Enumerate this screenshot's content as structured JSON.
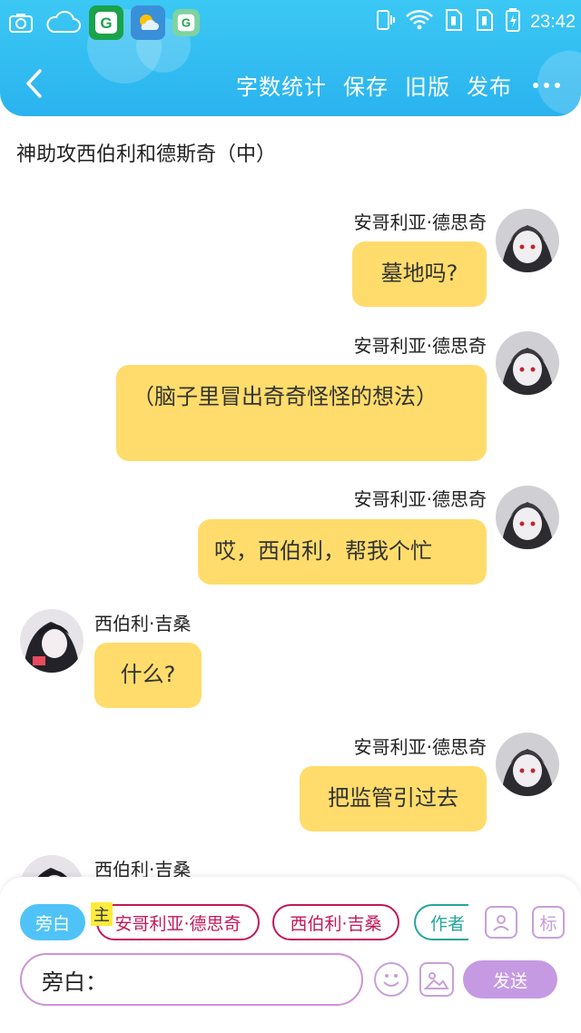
{
  "status_bar": {
    "time": "23:42",
    "left_icons": [
      "screenshot-icon",
      "cloud-icon",
      "app-g-icon",
      "weather-icon",
      "app-g-small-icon"
    ],
    "right_icons": [
      "vibrate-icon",
      "wifi-icon",
      "sim1-icon",
      "sim2-icon",
      "battery-icon"
    ]
  },
  "nav": {
    "back_icon": "chevron-left-icon",
    "actions": [
      "字数统计",
      "保存",
      "旧版",
      "发布"
    ],
    "more_icon": "more-dots-icon"
  },
  "title": "神助攻西伯利和德斯奇（中）",
  "messages": [
    {
      "side": "right",
      "name": "安哥利亚·德思奇",
      "text": "墓地吗?"
    },
    {
      "side": "right",
      "name": "安哥利亚·德思奇",
      "text": "（脑子里冒出奇奇怪怪的想法）"
    },
    {
      "side": "right",
      "name": "安哥利亚·德思奇",
      "text": "哎，西伯利，帮我个忙"
    },
    {
      "side": "left",
      "name": "西伯利·吉桑",
      "text": "什么?"
    },
    {
      "side": "right",
      "name": "安哥利亚·德思奇",
      "text": "把监管引过去"
    },
    {
      "side": "left",
      "name": "西伯利·吉桑",
      "text": ""
    }
  ],
  "composer": {
    "chips": [
      "旁白",
      "安哥利亚·德思奇",
      "西伯利·吉桑",
      "作者"
    ],
    "main_badge": "主",
    "role_icon": "person-card-icon",
    "tag_label": "标",
    "input_value": "旁白：",
    "emoji_icon": "smile-icon",
    "image_icon": "image-icon",
    "send_label": "发送"
  },
  "colors": {
    "header": "#2ab3ef",
    "bubble": "#ffdc6b",
    "accent_pink": "#c2185b",
    "send": "#c59ae3"
  }
}
